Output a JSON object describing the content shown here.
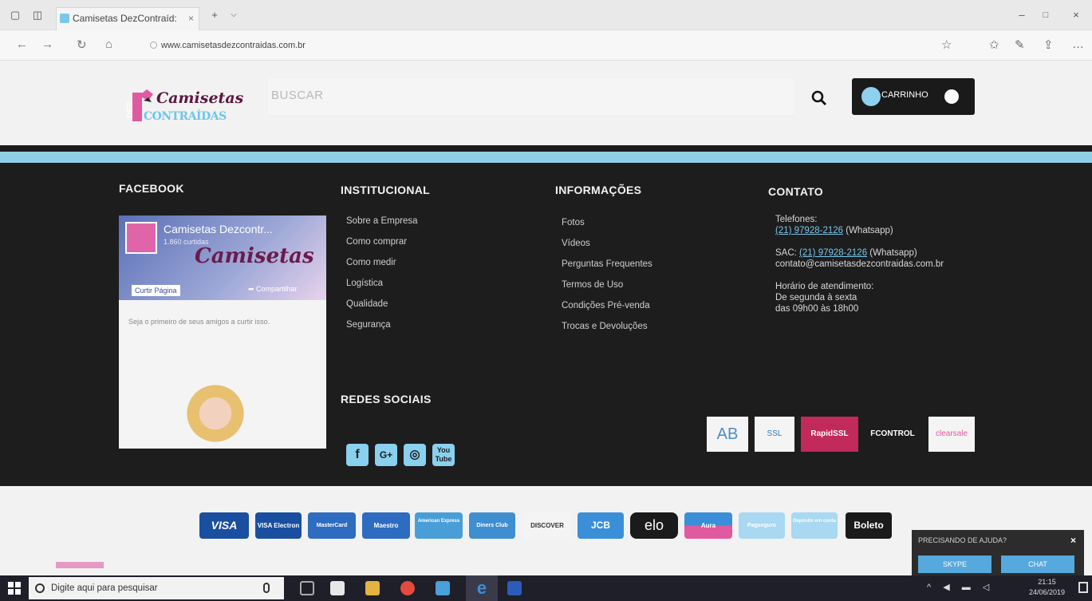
{
  "browser": {
    "tab_title": "Camisetas DezContraíd:",
    "url": "www.camisetasdezcontraidas.com.br"
  },
  "header": {
    "logo_line1": "Camisetas",
    "logo_line2": "CONTRAÍDAS",
    "logo_vertical": "DEZ",
    "search_placeholder": "BUSCAR",
    "cart_label": "CARRINHO"
  },
  "footer": {
    "facebook": {
      "heading": "FACEBOOK",
      "page_name": "Camisetas Dezcontr...",
      "sub": "1.860 curtidas",
      "logo_text": "Camisetas",
      "like_label": "Curtir Página",
      "share_label": "Compartilhar",
      "first_text": "Seja o primeiro de seus amigos a curtir isso."
    },
    "institucional": {
      "heading": "INSTITUCIONAL",
      "links": [
        "Sobre a Empresa",
        "Como comprar",
        "Como medir",
        "Logística",
        "Qualidade",
        "Segurança"
      ]
    },
    "informacoes": {
      "heading": "INFORMAÇÕES",
      "links": [
        "Fotos",
        "Vídeos",
        "Perguntas Frequentes",
        "Termos de Uso",
        "Condições Pré-venda",
        "Trocas e Devoluções"
      ]
    },
    "contato": {
      "heading": "CONTATO",
      "phones_label": "Telefones:",
      "phone": "(21) 97928-2126",
      "phone_suffix": "(Whatsapp)",
      "sac_label": "SAC:",
      "sac_phone": "(21) 97928-2126",
      "sac_suffix": "(Whatsapp)",
      "email": "contato@camisetasdezcontraidas.com.br",
      "hours_label": "Horário de atendimento:",
      "hours_days": "De segunda à sexta",
      "hours_time": "das 09h00 às 18h00"
    },
    "social": {
      "heading": "REDES SOCIAIS",
      "icons": [
        "facebook-icon",
        "google-plus-icon",
        "instagram-icon",
        "youtube-icon"
      ]
    },
    "seals": [
      "AB",
      "SSL",
      "RapidSSL",
      "FCONTROL",
      "clearsale"
    ]
  },
  "payments": [
    "VISA",
    "VISA Electron",
    "MasterCard",
    "Maestro",
    "American Express",
    "Diners Club",
    "DISCOVER",
    "JCB",
    "elo",
    "Aura",
    "Pagseguro",
    "Depósito em conta",
    "Boleto"
  ],
  "help_widget": {
    "title": "PRECISANDO DE AJUDA?",
    "skype": "SKYPE",
    "chat": "CHAT"
  },
  "taskbar": {
    "search_text": "Digite aqui para pesquisar",
    "time": "21:15",
    "date": "24/06/2019"
  }
}
